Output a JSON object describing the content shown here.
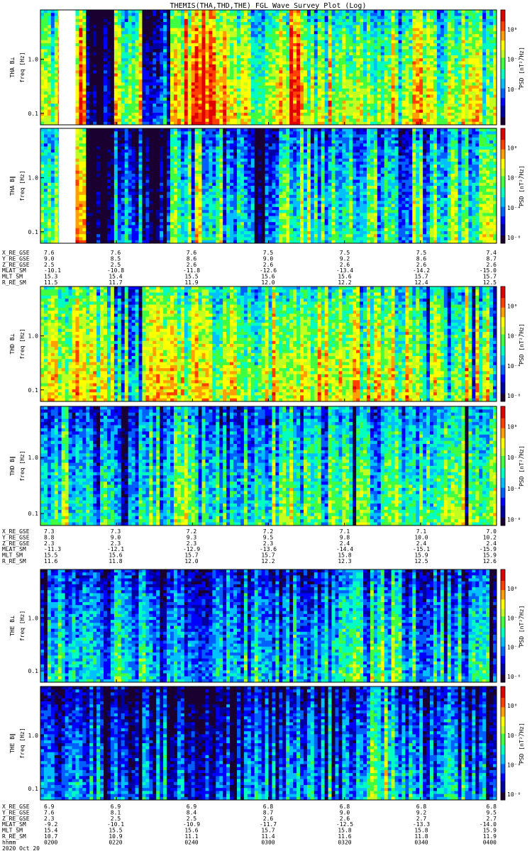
{
  "title": "THEMIS(THA,THD,THE) FGL Wave Survey Plot (Log)",
  "colors": {
    "colormap": [
      "#1a0030",
      "#0000a0",
      "#0000ff",
      "#0060ff",
      "#00c0ff",
      "#00ffc0",
      "#40ff40",
      "#c0ff20",
      "#ffff00",
      "#ffa000",
      "#ff4000",
      "#e00000"
    ],
    "frame": "#000000",
    "background": "#ffffff"
  },
  "chart_data": [
    {
      "type": "heatmap",
      "probe": "THA",
      "component": "B⊥",
      "ylabel_top": "THA B⊥",
      "ylabel": "freq [Hz]",
      "y_scale": "log",
      "yticks": [
        "1.0",
        "0.1"
      ],
      "cbar_label": "PSD [nT²/Hz]",
      "cbar_scale": "log",
      "cbar_ticks": [
        "10⁰",
        "10⁻²",
        "10⁻⁴"
      ],
      "data_gap": [
        0.04,
        0.07
      ],
      "intensity_profile": [
        0.55,
        0.75,
        0.8,
        0.0,
        0.0,
        0.62,
        0.6,
        0.28,
        0.25,
        0.68,
        0.78,
        0.85,
        0.82,
        0.7,
        0.58,
        0.42,
        0.68,
        0.8,
        0.72,
        0.52,
        0.62,
        0.6,
        0.55,
        0.5,
        0.6,
        0.58,
        0.6,
        0.55,
        0.57,
        0.6,
        0.58,
        0.6
      ]
    },
    {
      "type": "heatmap",
      "probe": "THA",
      "component": "B∥",
      "ylabel_top": "THA B∥",
      "ylabel": "freq [Hz]",
      "y_scale": "log",
      "yticks": [
        "1.0",
        "0.1"
      ],
      "cbar_label": "PSD [nT²/Hz]",
      "cbar_scale": "log",
      "cbar_ticks": [
        "10⁰",
        "10⁻²",
        "10⁻⁴",
        "10⁻⁶"
      ],
      "data_gap": [
        0.04,
        0.07
      ],
      "intensity_profile": [
        0.45,
        0.55,
        0.6,
        0.0,
        0.0,
        0.3,
        0.25,
        0.1,
        0.1,
        0.45,
        0.55,
        0.5,
        0.45,
        0.4,
        0.35,
        0.2,
        0.45,
        0.55,
        0.5,
        0.42,
        0.5,
        0.5,
        0.48,
        0.45,
        0.5,
        0.32,
        0.5,
        0.5,
        0.48,
        0.5,
        0.5,
        0.55
      ]
    },
    {
      "type": "heatmap",
      "probe": "THD",
      "component": "B⊥",
      "ylabel_top": "THD B⊥",
      "ylabel": "freq [Hz]",
      "y_scale": "log",
      "yticks": [
        "1.0",
        "0.1"
      ],
      "cbar_label": "PSD [nT²/Hz]",
      "cbar_scale": "log",
      "cbar_ticks": [
        "10⁰",
        "10⁻²",
        "10⁻⁴",
        "10⁻⁶"
      ],
      "intensity_profile": [
        0.6,
        0.68,
        0.72,
        0.65,
        0.6,
        0.42,
        0.45,
        0.62,
        0.7,
        0.68,
        0.65,
        0.62,
        0.55,
        0.6,
        0.58,
        0.5,
        0.62,
        0.65,
        0.62,
        0.6,
        0.58,
        0.62,
        0.6,
        0.58,
        0.6,
        0.62,
        0.6,
        0.6,
        0.58,
        0.6,
        0.58,
        0.55
      ]
    },
    {
      "type": "heatmap",
      "probe": "THD",
      "component": "B∥",
      "ylabel_top": "THD B∥",
      "ylabel": "freq [Hz]",
      "y_scale": "log",
      "yticks": [
        "1.0",
        "0.1"
      ],
      "cbar_label": "PSD [nT²/Hz]",
      "cbar_scale": "log",
      "cbar_ticks": [
        "10⁰",
        "10⁻²",
        "10⁻⁴",
        "10⁻⁶"
      ],
      "intensity_profile": [
        0.48,
        0.45,
        0.42,
        0.4,
        0.35,
        0.25,
        0.32,
        0.45,
        0.5,
        0.48,
        0.45,
        0.42,
        0.35,
        0.42,
        0.4,
        0.3,
        0.45,
        0.48,
        0.45,
        0.42,
        0.45,
        0.47,
        0.45,
        0.44,
        0.45,
        0.47,
        0.45,
        0.46,
        0.45,
        0.47,
        0.46,
        0.45
      ]
    },
    {
      "type": "heatmap",
      "probe": "THE",
      "component": "B⊥",
      "ylabel_top": "THE B⊥",
      "ylabel": "freq [Hz]",
      "y_scale": "log",
      "yticks": [
        "1.0",
        "0.1"
      ],
      "cbar_label": "PSD [nT²/Hz]",
      "cbar_scale": "log",
      "cbar_ticks": [
        "10⁰",
        "10⁻²",
        "10⁻⁴",
        "10⁻⁶"
      ],
      "intensity_profile": [
        0.4,
        0.42,
        0.38,
        0.4,
        0.36,
        0.38,
        0.4,
        0.36,
        0.35,
        0.33,
        0.34,
        0.32,
        0.35,
        0.33,
        0.36,
        0.34,
        0.33,
        0.32,
        0.34,
        0.33,
        0.36,
        0.4,
        0.38,
        0.52,
        0.6,
        0.45,
        0.36,
        0.35,
        0.34,
        0.33,
        0.35,
        0.34
      ]
    },
    {
      "type": "heatmap",
      "probe": "THE",
      "component": "B∥",
      "ylabel_top": "THE B∥",
      "ylabel": "freq [Hz]",
      "y_scale": "log",
      "yticks": [
        "1.0",
        "0.1"
      ],
      "cbar_label": "PSD [nT²/Hz]",
      "cbar_scale": "log",
      "cbar_ticks": [
        "10⁰",
        "10⁻²",
        "10⁻⁴",
        "10⁻⁶"
      ],
      "intensity_profile": [
        0.32,
        0.3,
        0.28,
        0.27,
        0.26,
        0.25,
        0.24,
        0.23,
        0.22,
        0.22,
        0.21,
        0.2,
        0.22,
        0.21,
        0.23,
        0.25,
        0.22,
        0.24,
        0.25,
        0.28,
        0.3,
        0.3,
        0.33,
        0.42,
        0.5,
        0.35,
        0.3,
        0.3,
        0.28,
        0.28,
        0.27,
        0.3
      ]
    }
  ],
  "ephemeris_blocks": [
    {
      "labels": [
        "X_RE_GSE",
        "Y_RE_GSE",
        "Z_RE_GSE",
        "MLAT_SM",
        "MLT_SM",
        "R_RE_SM"
      ],
      "rows": [
        [
          "7.6",
          "7.6",
          "7.6",
          "7.5",
          "7.5",
          "7.5",
          "7.4"
        ],
        [
          "9.0",
          "8.5",
          "8.6",
          "9.0",
          "9.2",
          "8.6",
          "8.7"
        ],
        [
          "2.5",
          "2.5",
          "2.6",
          "2.6",
          "2.6",
          "2.6",
          "2.6"
        ],
        [
          "-10.1",
          "-10.8",
          "-11.8",
          "-12.6",
          "-13.4",
          "-14.2",
          "-15.0"
        ],
        [
          "15.3",
          "15.4",
          "15.5",
          "15.6",
          "15.6",
          "15.7",
          "15.7"
        ],
        [
          "11.5",
          "11.7",
          "11.9",
          "12.0",
          "12.2",
          "12.4",
          "12.5"
        ]
      ]
    },
    {
      "labels": [
        "X_RE_GSE",
        "Y_RE_GSE",
        "Z_RE_GSE",
        "MLAT_SM",
        "MLT_SM",
        "R_RE_SM"
      ],
      "rows": [
        [
          "7.3",
          "7.3",
          "7.2",
          "7.2",
          "7.1",
          "7.1",
          "7.0"
        ],
        [
          "8.8",
          "9.0",
          "9.3",
          "9.5",
          "9.8",
          "10.0",
          "10.2"
        ],
        [
          "2.3",
          "2.3",
          "2.3",
          "2.3",
          "2.4",
          "2.4",
          "2.4"
        ],
        [
          "-11.3",
          "-12.1",
          "-12.9",
          "-13.6",
          "-14.4",
          "-15.1",
          "-15.9"
        ],
        [
          "15.5",
          "15.6",
          "15.7",
          "15.7",
          "15.8",
          "15.9",
          "15.9"
        ],
        [
          "11.6",
          "11.8",
          "12.0",
          "12.2",
          "12.3",
          "12.5",
          "12.6"
        ]
      ]
    },
    {
      "labels": [
        "X_RE_GSE",
        "Y_RE_GSE",
        "Z_RE_GSE",
        "MLAT_SM",
        "MLT_SM",
        "R_RE_SM",
        "hhmm",
        "2020 Oct 20"
      ],
      "rows": [
        [
          "6.9",
          "6.9",
          "6.9",
          "6.8",
          "6.8",
          "6.8",
          "6.8"
        ],
        [
          "7.6",
          "8.1",
          "8.4",
          "8.7",
          "9.0",
          "9.2",
          "9.5"
        ],
        [
          "2.3",
          "2.5",
          "2.5",
          "2.6",
          "2.6",
          "2.7",
          "2.7"
        ],
        [
          "-9.2",
          "-10.1",
          "-10.9",
          "-11.7",
          "-12.5",
          "-13.3",
          "-14.0"
        ],
        [
          "15.4",
          "15.5",
          "15.6",
          "15.7",
          "15.8",
          "15.8",
          "15.9"
        ],
        [
          "10.7",
          "10.9",
          "11.1",
          "11.4",
          "11.6",
          "11.8",
          "11.9"
        ],
        [
          "0200",
          "0220",
          "0240",
          "0300",
          "0320",
          "0340",
          "0400"
        ]
      ]
    }
  ]
}
